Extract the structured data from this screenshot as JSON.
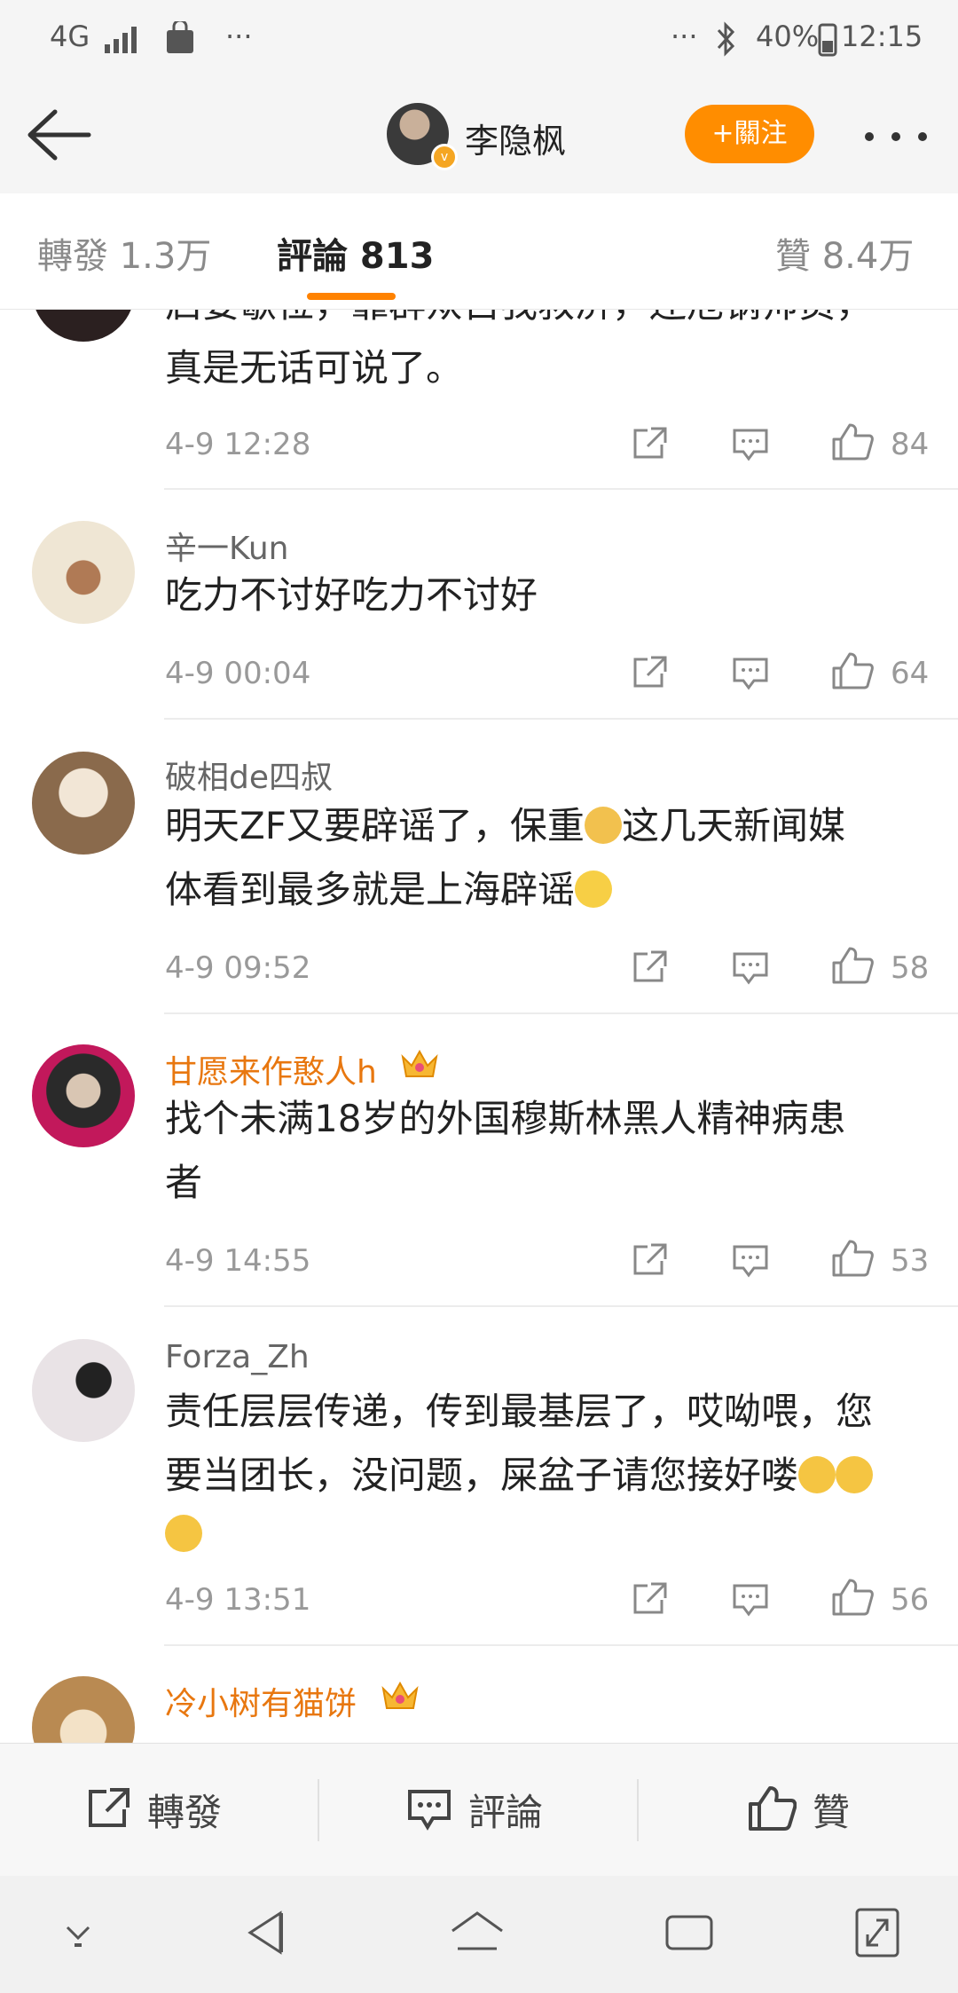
{
  "status_bar": {
    "network": "4G",
    "left_more": "···",
    "right_more": "···",
    "battery": "40%",
    "time": "12:15"
  },
  "header": {
    "back_icon": "arrow-left-icon",
    "user_name": "李隐枫",
    "follow_label": "+關注",
    "more_icon": "more-dots-icon"
  },
  "tabs": [
    {
      "label": "轉發 1.3万"
    },
    {
      "label": "評論 813"
    },
    {
      "label": "贊 8.4万"
    }
  ],
  "comments": [
    {
      "name": "",
      "text_lines": [
        "启要歇位，靠群众自我救济，还危钢帅员，",
        "真是无话可说了。"
      ],
      "time": "4-9 12:28",
      "likes": "84"
    },
    {
      "name": "辛一Kun",
      "text_lines": [
        "吃力不讨好吃力不讨好"
      ],
      "time": "4-9 00:04",
      "likes": "64"
    },
    {
      "name": "破相de四叔",
      "text_lines": [
        "明天ZF又要辟谣了，保重",
        "这几天新闻媒",
        "体看到最多就是上海辟谣"
      ],
      "time": "4-9 09:52",
      "likes": "58"
    },
    {
      "name": "甘愿来作憨人h",
      "text_lines": [
        "找个未满18岁的外国穆斯林黑人精神病患",
        "者"
      ],
      "time": "4-9 14:55",
      "likes": "53"
    },
    {
      "name": "Forza_Zh",
      "text_lines": [
        "责任层层传递，传到最基层了，哎呦喂，您",
        "要当团长，没问题，屎盆子请您接好喽"
      ],
      "time": "4-9 13:51",
      "likes": "56"
    },
    {
      "name": "冷小树有猫饼",
      "text_lines": [
        ""
      ],
      "time": "",
      "likes": ""
    }
  ],
  "action_bar": {
    "repost": "轉發",
    "comment": "評論",
    "like": "贊"
  },
  "colors": {
    "accent": "#ff8200",
    "vip_name": "#e8770f",
    "follow_bg": "#ff8d00"
  }
}
